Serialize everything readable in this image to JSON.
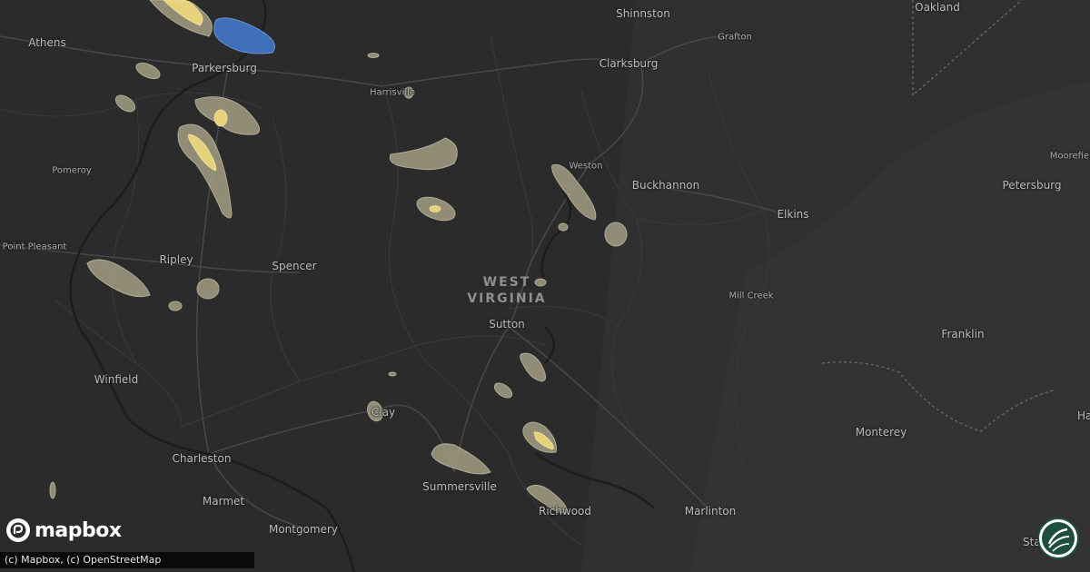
{
  "map": {
    "state_label_line1": "WEST",
    "state_label_line2": "VIRGINIA",
    "cities": [
      {
        "name": "Shinnston",
        "size": "normal"
      },
      {
        "name": "Oakland",
        "size": "normal"
      },
      {
        "name": "Grafton",
        "size": "small"
      },
      {
        "name": "Athens",
        "size": "normal"
      },
      {
        "name": "Parkersburg",
        "size": "normal"
      },
      {
        "name": "Clarksburg",
        "size": "normal"
      },
      {
        "name": "Harrisville",
        "size": "small"
      },
      {
        "name": "Pomeroy",
        "size": "small"
      },
      {
        "name": "Weston",
        "size": "small"
      },
      {
        "name": "Buckhannon",
        "size": "normal"
      },
      {
        "name": "Moorefield",
        "size": "small"
      },
      {
        "name": "Petersburg",
        "size": "normal"
      },
      {
        "name": "Elkins",
        "size": "normal"
      },
      {
        "name": "Point Pleasant",
        "size": "small"
      },
      {
        "name": "Ripley",
        "size": "normal"
      },
      {
        "name": "Spencer",
        "size": "normal"
      },
      {
        "name": "Mill Creek",
        "size": "small"
      },
      {
        "name": "Sutton",
        "size": "normal"
      },
      {
        "name": "Franklin",
        "size": "normal"
      },
      {
        "name": "Winfield",
        "size": "normal"
      },
      {
        "name": "Clay",
        "size": "normal"
      },
      {
        "name": "Monterey",
        "size": "normal"
      },
      {
        "name": "Harrisonburg",
        "size": "normal"
      },
      {
        "name": "Charleston",
        "size": "normal"
      },
      {
        "name": "Summersville",
        "size": "normal"
      },
      {
        "name": "Richwood",
        "size": "normal"
      },
      {
        "name": "Marlinton",
        "size": "normal"
      },
      {
        "name": "Marmet",
        "size": "normal"
      },
      {
        "name": "Montgomery",
        "size": "normal"
      },
      {
        "name": "Staunton",
        "size": "normal"
      }
    ]
  },
  "branding": {
    "logo_text": "mapbox",
    "attribution": "(c) Mapbox, (c) OpenStreetMap"
  },
  "colors": {
    "background": "#2b2b2b",
    "swath_light": "#a39d84",
    "swath_yellow": "#e6d27a",
    "swath_blue": "#3f6fb8",
    "labels": "#b9b9b9"
  }
}
